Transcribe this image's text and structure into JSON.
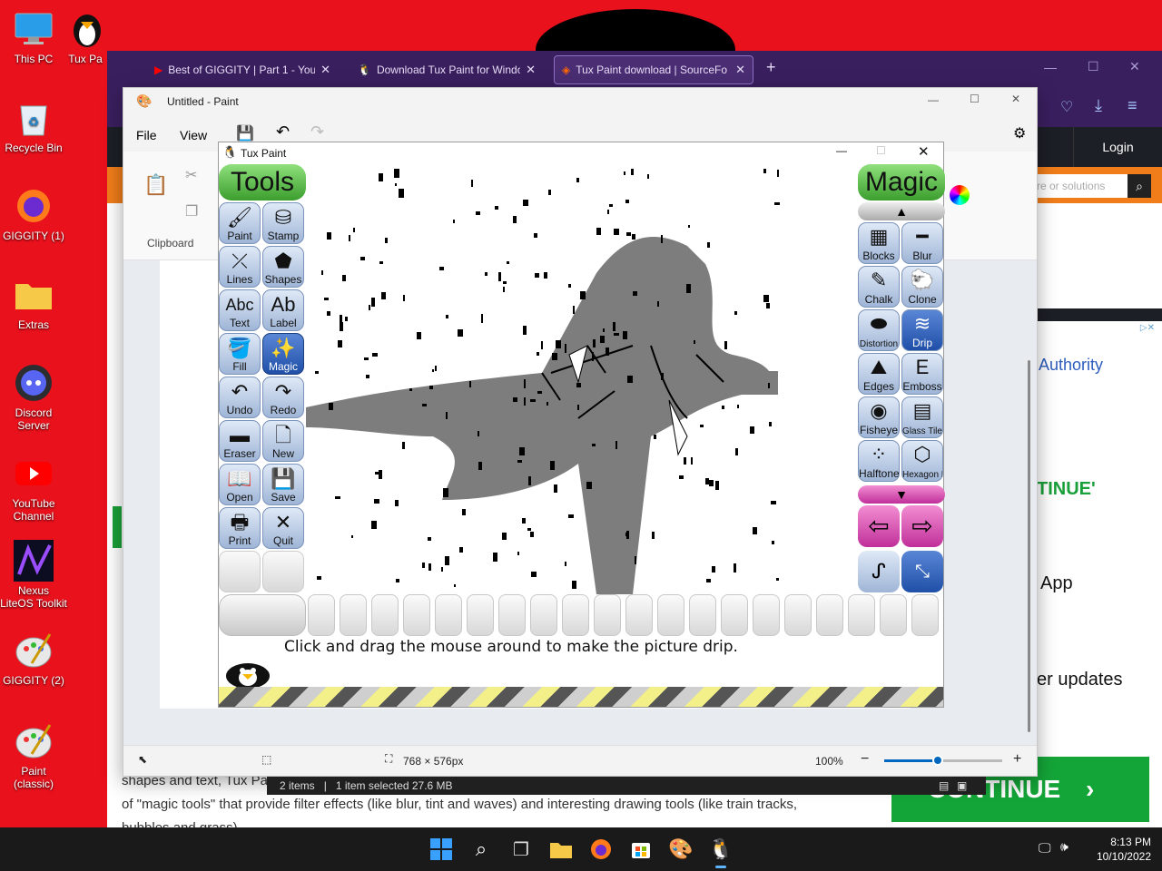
{
  "desktop": {
    "icons": [
      {
        "label": "This PC"
      },
      {
        "label": "Tux Pa"
      },
      {
        "label": "Recycle Bin"
      },
      {
        "label": "GIGGITY (1)"
      },
      {
        "label": "Extras"
      },
      {
        "label": "Discord Server"
      },
      {
        "label": "YouTube Channel"
      },
      {
        "label": "Nexus LiteOS Toolkit"
      },
      {
        "label": "GIGGITY (2)"
      },
      {
        "label": "Paint (classic)"
      }
    ]
  },
  "browser": {
    "tabs": [
      {
        "label": "Best of GIGGITY | Part 1 - YouTub",
        "icon": "youtube-icon"
      },
      {
        "label": "Download Tux Paint for Windo",
        "icon": "tux-icon"
      },
      {
        "label": "Tux Paint download | SourceFo",
        "icon": "sourceforge-icon"
      }
    ],
    "new_tab": "+",
    "login": "Login",
    "search_placeholder": "re or solutions",
    "side": {
      "authority": "Authority",
      "continue_partial": "TINUE'",
      "app": "App",
      "updates": "er updates",
      "continue_button": "CONTINUE"
    },
    "article": {
      "line1": "shapes and text, Tux Pa",
      "line2": "of \"magic tools\" that provide filter effects (like blur, tint and waves) and interesting drawing tools (like train tracks,",
      "line3": "bubbles and grass)."
    }
  },
  "paint": {
    "title": "Untitled - Paint",
    "menu": {
      "file": "File",
      "view": "View"
    },
    "ribbon": {
      "clipboard_label": "Clipboard"
    },
    "status": {
      "dimensions": "768 × 576px",
      "zoom": "100%",
      "zoom_level": 0.45
    }
  },
  "explorer": {
    "items": "2 items",
    "selected": "1 item selected  27.6 MB"
  },
  "tuxpaint": {
    "title": "Tux Paint",
    "tools_header": "Tools",
    "magic_header": "Magic",
    "tools": [
      {
        "label": "Paint",
        "glyph": "🖌"
      },
      {
        "label": "Stamp",
        "glyph": "⛁"
      },
      {
        "label": "Lines",
        "glyph": "⤫"
      },
      {
        "label": "Shapes",
        "glyph": "⬟"
      },
      {
        "label": "Text",
        "glyph": "Abc"
      },
      {
        "label": "Label",
        "glyph": "Ab"
      },
      {
        "label": "Fill",
        "glyph": "🪣"
      },
      {
        "label": "Magic",
        "glyph": "✨"
      },
      {
        "label": "Undo",
        "glyph": "↶"
      },
      {
        "label": "Redo",
        "glyph": "↷"
      },
      {
        "label": "Eraser",
        "glyph": "▬"
      },
      {
        "label": "New",
        "glyph": "🗋"
      },
      {
        "label": "Open",
        "glyph": "📖"
      },
      {
        "label": "Save",
        "glyph": "💾"
      },
      {
        "label": "Print",
        "glyph": "🖶"
      },
      {
        "label": "Quit",
        "glyph": "✕"
      }
    ],
    "magic": [
      {
        "label": "Blocks",
        "glyph": "▦"
      },
      {
        "label": "Blur",
        "glyph": "━"
      },
      {
        "label": "Chalk",
        "glyph": "✎"
      },
      {
        "label": "Clone",
        "glyph": "🐑"
      },
      {
        "label": "Distortion",
        "glyph": "⬬"
      },
      {
        "label": "Drip",
        "glyph": "≋"
      },
      {
        "label": "Edges",
        "glyph": "⛰"
      },
      {
        "label": "Emboss",
        "glyph": "E"
      },
      {
        "label": "Fisheye",
        "glyph": "◉"
      },
      {
        "label": "Glass Tile",
        "glyph": "▤"
      },
      {
        "label": "Halftone",
        "glyph": "⁘"
      },
      {
        "label": "Hexagon Mosaic",
        "glyph": "⬡"
      }
    ],
    "message": "Click and drag the mouse around to make the picture drip."
  },
  "taskbar": {
    "time": "8:13 PM",
    "date": "10/10/2022"
  }
}
